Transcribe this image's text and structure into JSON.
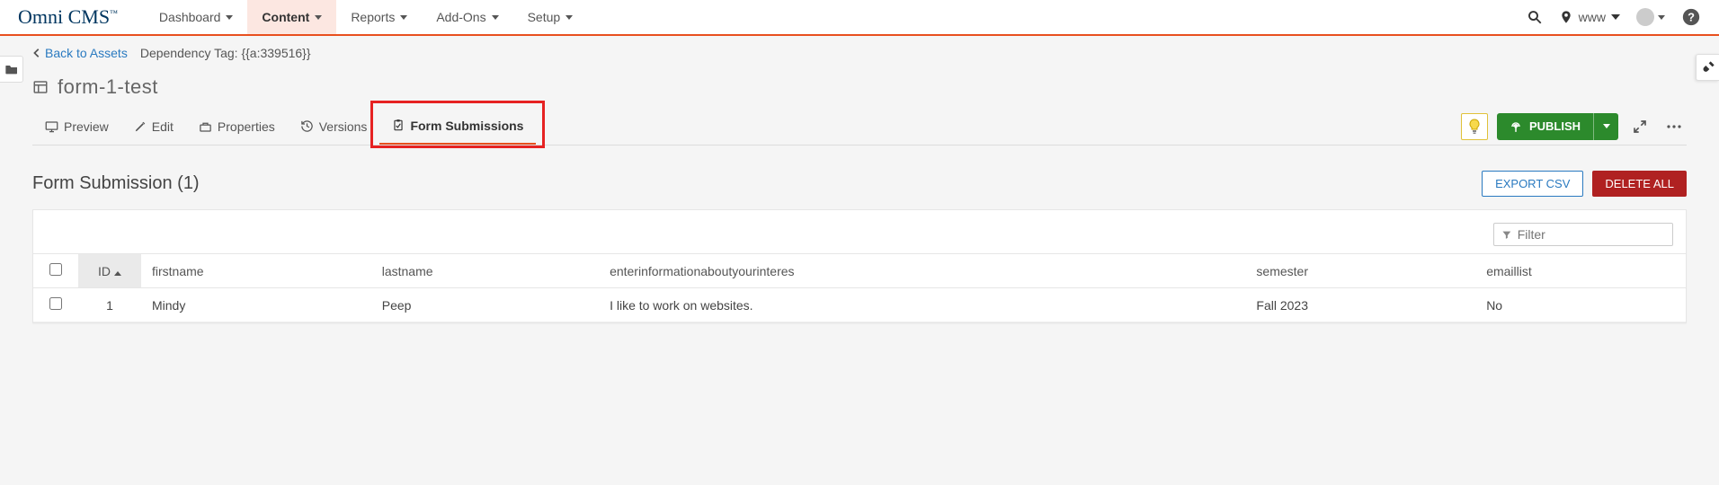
{
  "brand": "Omni CMS",
  "brand_tm": "™",
  "topnav": {
    "items": [
      {
        "label": "Dashboard"
      },
      {
        "label": "Content"
      },
      {
        "label": "Reports"
      },
      {
        "label": "Add-Ons"
      },
      {
        "label": "Setup"
      }
    ],
    "site_label": "www"
  },
  "breadcrumb": {
    "back_label": "Back to Assets",
    "dependency_tag_label": "Dependency Tag:",
    "dependency_tag_value": "{{a:339516}}"
  },
  "page_title": "form-1-test",
  "tabs": {
    "preview": "Preview",
    "edit": "Edit",
    "properties": "Properties",
    "versions": "Versions",
    "form_submissions": "Form Submissions"
  },
  "actions": {
    "publish": "PUBLISH",
    "export_csv": "EXPORT CSV",
    "delete_all": "DELETE ALL"
  },
  "section": {
    "title": "Form Submission (1)"
  },
  "filter": {
    "placeholder": "Filter"
  },
  "table": {
    "columns": {
      "id": "ID",
      "firstname": "firstname",
      "lastname": "lastname",
      "interests": "enterinformationaboutyourinteres",
      "semester": "semester",
      "emaillist": "emaillist"
    },
    "rows": [
      {
        "id": "1",
        "firstname": "Mindy",
        "lastname": "Peep",
        "interests": "I like to work on websites.",
        "semester": "Fall 2023",
        "emaillist": "No"
      }
    ]
  }
}
